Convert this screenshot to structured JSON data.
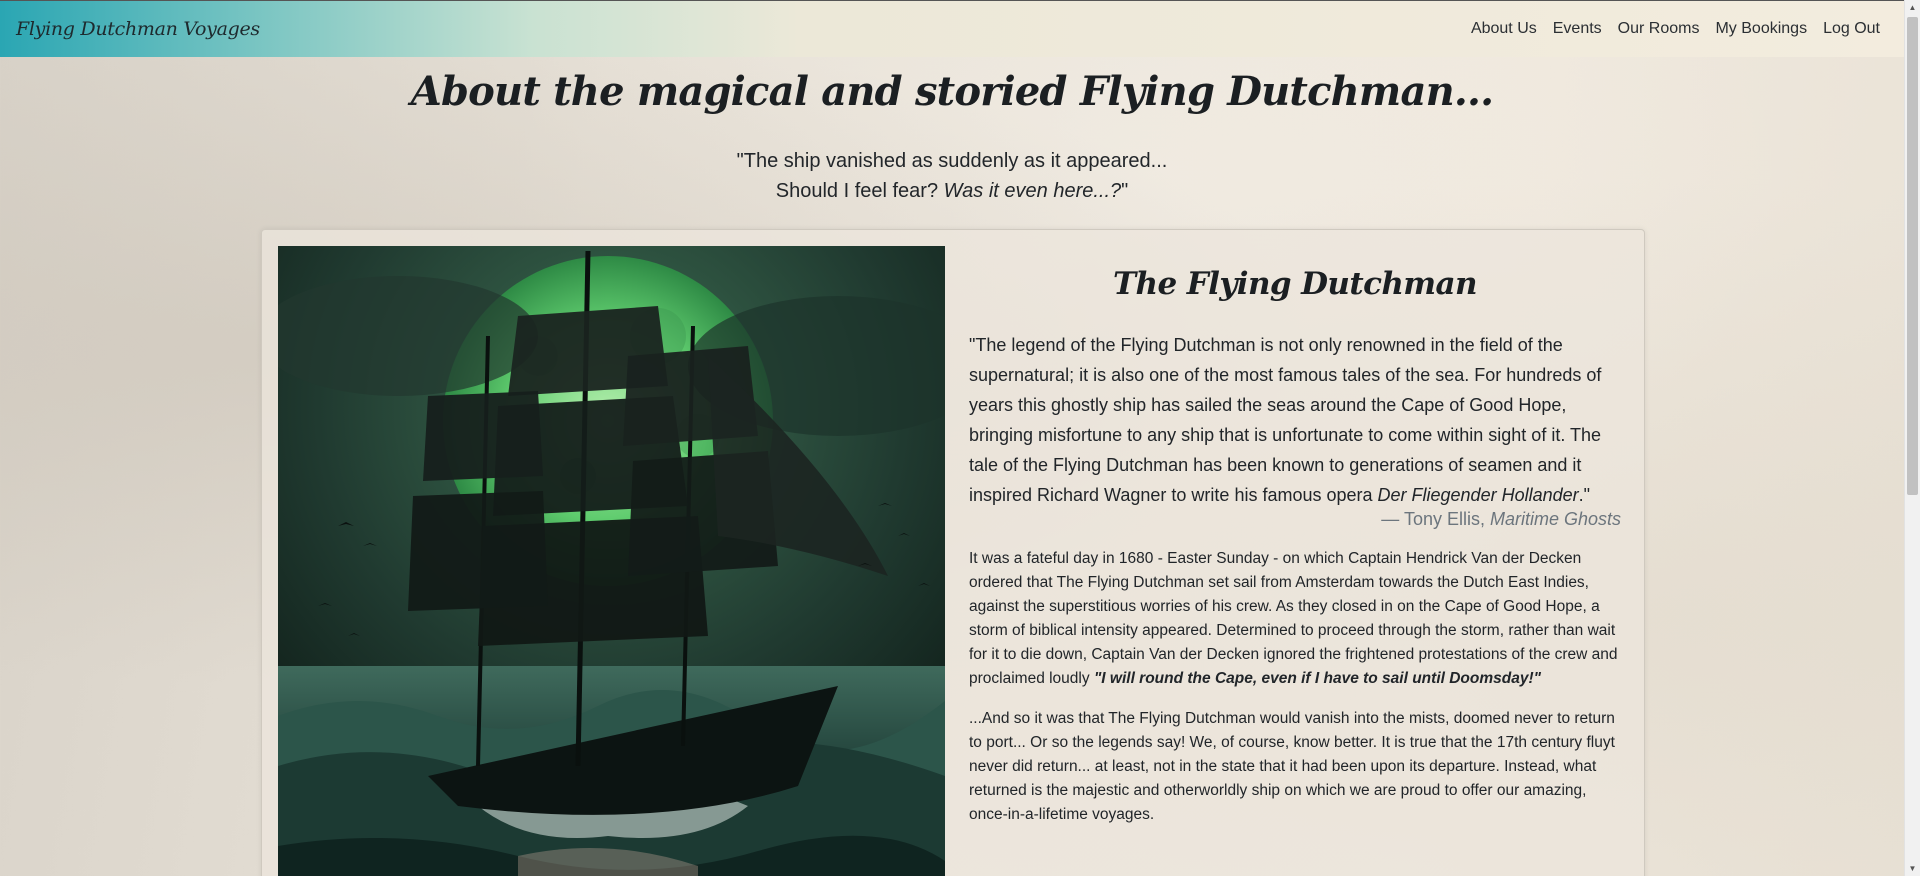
{
  "navbar": {
    "brand": "Flying Dutchman Voyages",
    "links": [
      "About Us",
      "Events",
      "Our Rooms",
      "My Bookings",
      "Log Out"
    ]
  },
  "header": {
    "title": "About the magical and storied Flying Dutchman...",
    "quote_line1": "\"The ship vanished as suddenly as it appeared...",
    "quote_line2_start": "Should I feel fear? ",
    "quote_line2_italic": "Was it even here...?",
    "quote_line2_end": "\""
  },
  "card": {
    "title": "The Flying Dutchman",
    "blockquote_main": "\"The legend of the Flying Dutchman is not only renowned in the field of the supernatural; it is also one of the most famous tales of the sea. For hundreds of years this ghostly ship has sailed the seas around the Cape of Good Hope, bringing misfortune to any ship that is unfortunate to come within sight of it. The tale of the Flying Dutchman has been known to generations of seamen and it inspired Richard Wagner to write his famous opera ",
    "blockquote_italic": "Der Fliegender Hollander",
    "blockquote_end": ".\"",
    "cite_author": "—  Tony Ellis, ",
    "cite_source": "Maritime Ghosts",
    "para1_text": "It was a fateful day in 1680 - Easter Sunday - on which Captain Hendrick Van der Decken ordered that The Flying Dutchman set sail from Amsterdam towards the Dutch East Indies, against the superstitious worries of his crew. As they closed in on the Cape of Good Hope, a storm of biblical intensity appeared. Determined to proceed through the storm, rather than wait for it to die down, Captain Van der Decken ignored the frightened protestations of the crew and proclaimed loudly ",
    "para1_bold": "\"I will round the Cape, even if I have to sail until Doomsday!\"",
    "para2": "...And so it was that The Flying Dutchman would vanish into the mists, doomed never to return to port... Or so the legends say! We, of course, know better. It is true that the 17th century fluyt never did return... at least, not in the state that it had been upon its departure. Instead, what returned is the majestic and otherworldly ship on which we are proud to offer our amazing, once-in-a-lifetime voyages."
  },
  "colors": {
    "nav_teal": "#2aa6b3",
    "text_dark": "#212529",
    "cite_gray": "#6c757d",
    "moon_green": "#4fc26a"
  }
}
